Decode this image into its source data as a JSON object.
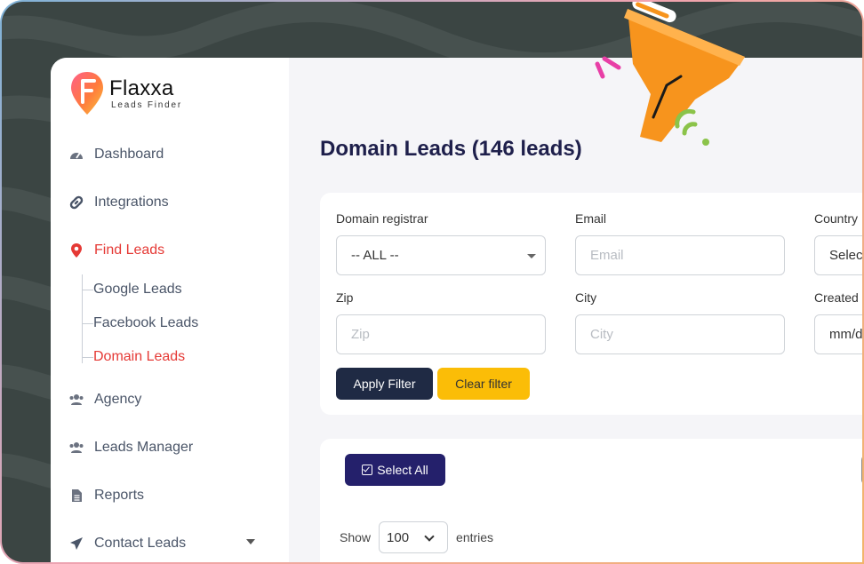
{
  "app": {
    "name": "Flaxxa",
    "tagline": "Leads Finder"
  },
  "sidebar": {
    "items": [
      {
        "label": "Dashboard",
        "icon": "gauge-icon"
      },
      {
        "label": "Integrations",
        "icon": "link-icon"
      },
      {
        "label": "Find Leads",
        "icon": "map-pin-icon",
        "active": true
      },
      {
        "label": "Agency",
        "icon": "users-icon"
      },
      {
        "label": "Leads Manager",
        "icon": "users-icon"
      },
      {
        "label": "Reports",
        "icon": "document-icon"
      },
      {
        "label": "Contact Leads",
        "icon": "paper-plane-icon"
      }
    ],
    "subitems": [
      {
        "label": "Google Leads"
      },
      {
        "label": "Facebook Leads"
      },
      {
        "label": "Domain Leads",
        "active": true
      }
    ]
  },
  "main": {
    "title": "Domain Leads (146 leads)",
    "filters": {
      "registrar_label": "Domain registrar",
      "registrar_value": "-- ALL --",
      "email_label": "Email",
      "email_placeholder": "Email",
      "country_label": "Country",
      "country_value": "Selec",
      "zip_label": "Zip",
      "zip_placeholder": "Zip",
      "city_label": "City",
      "city_placeholder": "City",
      "created_label": "Created d",
      "created_value": "mm/d",
      "apply_label": "Apply Filter",
      "clear_label": "Clear filter"
    },
    "table": {
      "select_all_label": "Select All",
      "show_label": "Show",
      "entries_value": "100",
      "entries_label": "entries"
    }
  },
  "colors": {
    "accent_red": "#e53935",
    "navy": "#1e1f4b",
    "select_all_bg": "#24206b",
    "clear_btn": "#fbbd07",
    "funnel": "#f7941d"
  }
}
